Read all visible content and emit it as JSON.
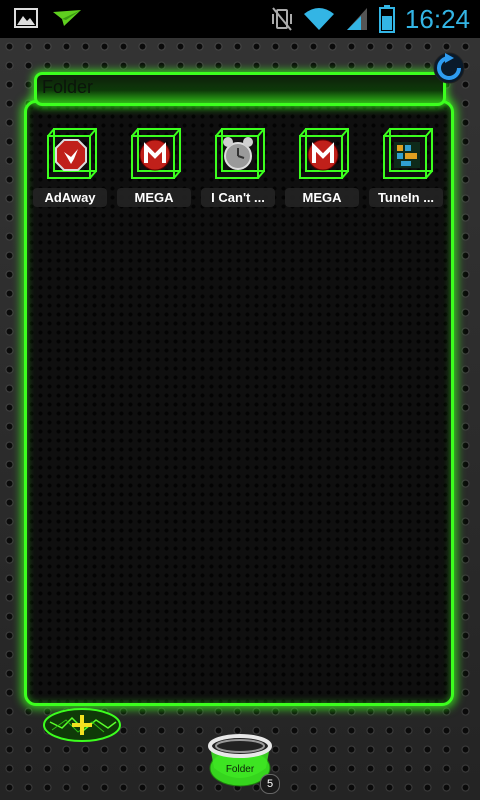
{
  "status_bar": {
    "time": "16:24",
    "icons": [
      "image-notification-icon",
      "paper-plane-notification-icon",
      "vibrate-icon",
      "wifi-icon",
      "signal-icon",
      "battery-icon"
    ]
  },
  "folder": {
    "title": "Folder",
    "apps": [
      {
        "label": "AdAway",
        "icon": "adaway-icon"
      },
      {
        "label": "MEGA",
        "icon": "mega-icon"
      },
      {
        "label": "I Can't ...",
        "icon": "alarm-clock-icon"
      },
      {
        "label": "MEGA",
        "icon": "mega-icon"
      },
      {
        "label": "TuneIn ...",
        "icon": "tunein-icon"
      }
    ]
  },
  "dock": {
    "folder_label": "Folder",
    "folder_count": "5"
  },
  "colors": {
    "accent": "#3cff1e",
    "clock": "#33b5e5"
  }
}
